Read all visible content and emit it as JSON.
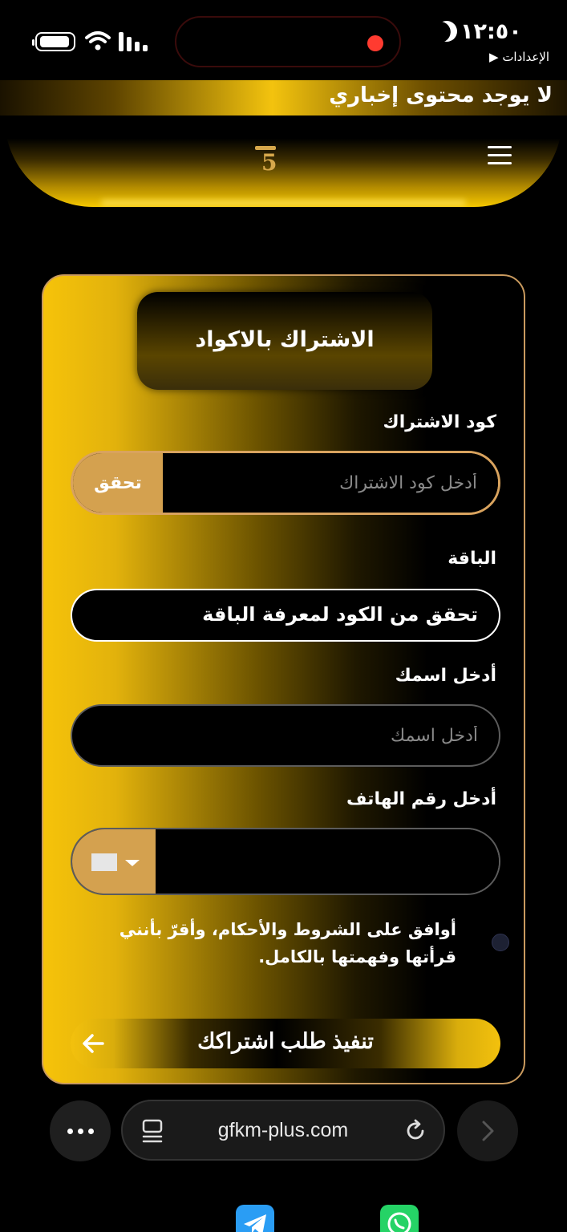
{
  "status_bar": {
    "time": "١٢:٥٠",
    "back_app": "▶ الإعدادات"
  },
  "ticker": {
    "text": "لا يوجد محتوى إخباري"
  },
  "header": {
    "logo_text": "5"
  },
  "card": {
    "title": "الاشتراك بالاكواد",
    "code_label": "كود الاشتراك",
    "code_placeholder": "أدخل كود الاشتراك",
    "verify_label": "تحقق",
    "package_label": "الباقة",
    "package_value": "تحقق من الكود لمعرفة الباقة",
    "name_label": "أدخل اسمك",
    "name_placeholder": "أدخل اسمك",
    "phone_label": "أدخل رقم الهاتف",
    "terms_text": "أوافق على الشروط والأحكام، وأقرّ بأنني قرأتها وفهمتها بالكامل.",
    "submit_label": "تنفيذ طلب اشتراكك"
  },
  "browser": {
    "url": "gfkm-plus.com"
  },
  "colors": {
    "accent_gold": "#f3c10d",
    "button_tan": "#d4a14f",
    "card_border": "#c99a5e"
  }
}
